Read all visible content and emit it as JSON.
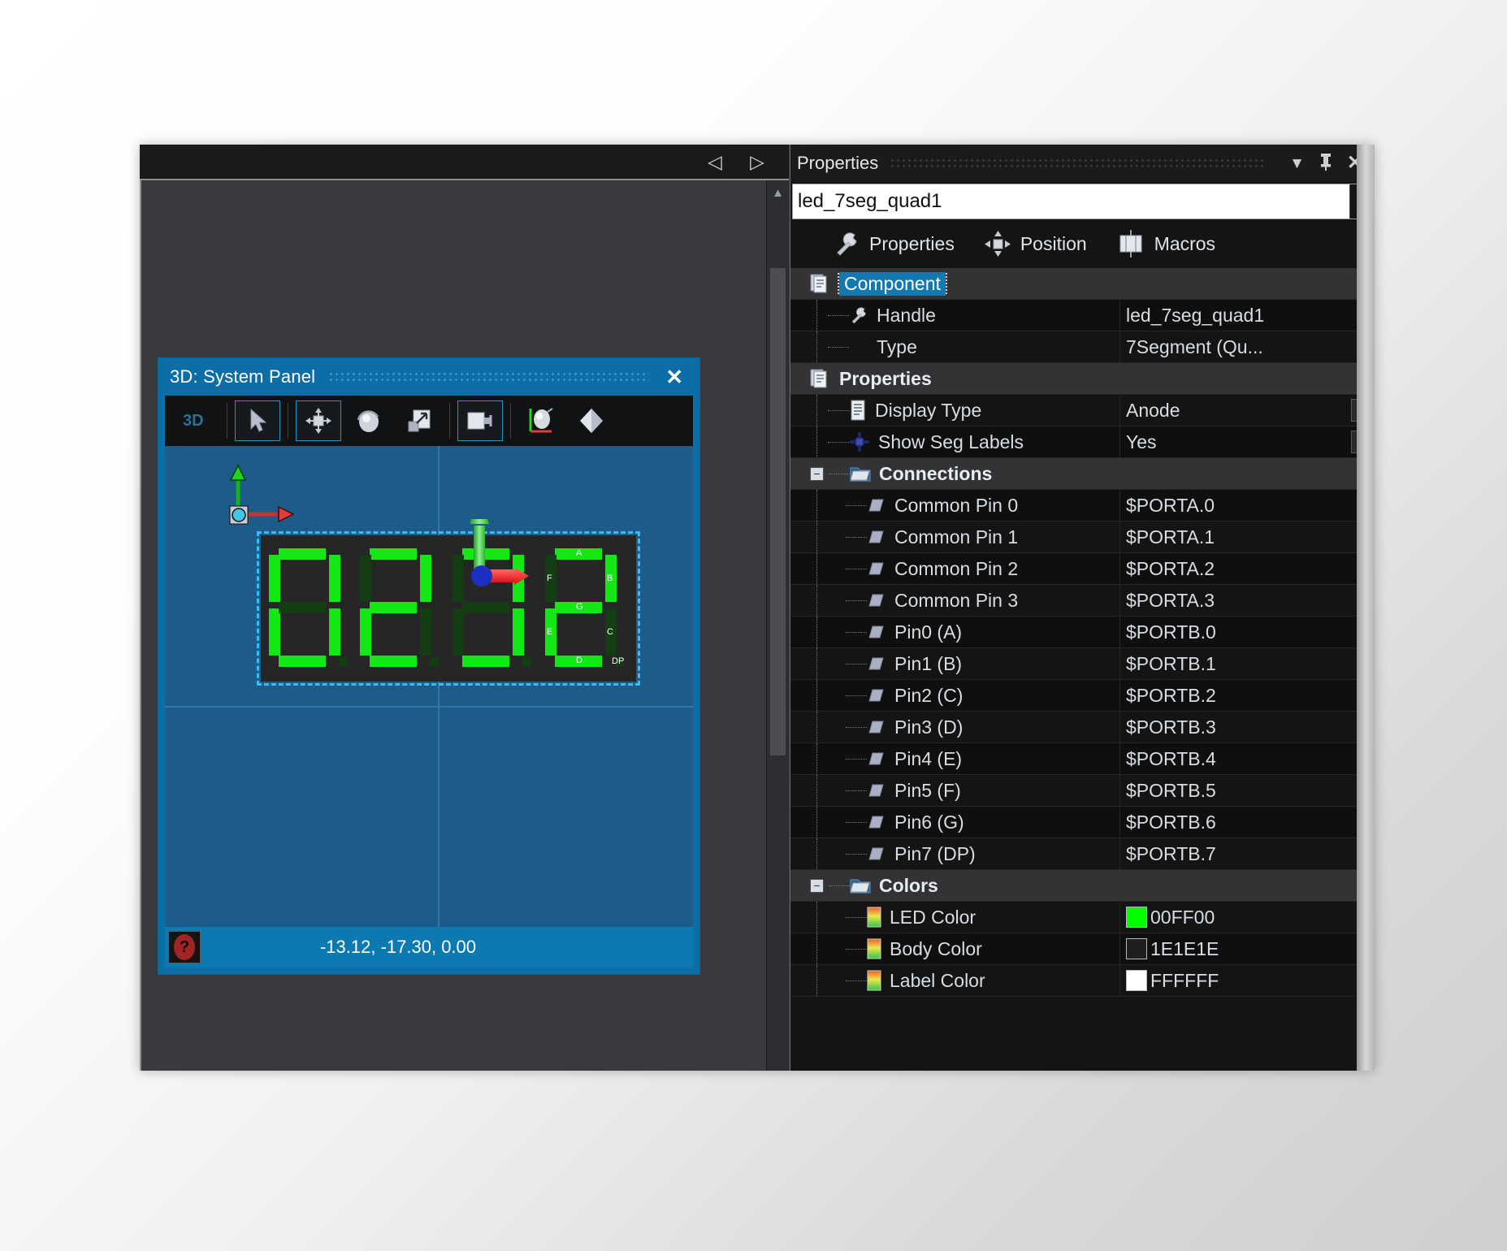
{
  "editor": {
    "nav_prev": "◁",
    "nav_next": "▷"
  },
  "panel3d": {
    "title": "3D: System Panel",
    "close_label": "✕",
    "toolbar": {
      "mode_label": "3D",
      "buttons": [
        {
          "name": "select-tool",
          "icon": "cursor-arrow-icon",
          "active": true
        },
        {
          "name": "move-tool",
          "icon": "move-arrows-icon",
          "active": true
        },
        {
          "name": "rotate-tool",
          "icon": "rotate-sphere-icon",
          "active": false
        },
        {
          "name": "scale-tool",
          "icon": "scale-arrow-icon",
          "active": false
        },
        {
          "name": "camera-tool",
          "icon": "camera-icon",
          "active": true
        },
        {
          "name": "lighting-tool",
          "icon": "light-sphere-axes-icon",
          "active": false
        },
        {
          "name": "render-tool",
          "icon": "cube-icon",
          "active": false
        }
      ]
    },
    "status": {
      "help_glyph": "?",
      "coordinates": "-13.12, -17.30, 0.00"
    },
    "component": {
      "digits": [
        {
          "value": "0",
          "segments": {
            "A": true,
            "B": true,
            "C": true,
            "D": true,
            "E": true,
            "F": true,
            "G": false,
            "DP": false
          }
        },
        {
          "value": "2",
          "segments": {
            "A": true,
            "B": true,
            "C": false,
            "D": true,
            "E": true,
            "F": false,
            "G": true,
            "DP": false
          }
        },
        {
          "value": "7",
          "segments": {
            "A": true,
            "B": true,
            "C": true,
            "D": true,
            "E": false,
            "F": false,
            "G": false,
            "DP": false
          }
        },
        {
          "value": "2",
          "segments": {
            "A": true,
            "B": true,
            "C": false,
            "D": true,
            "E": true,
            "F": false,
            "G": true,
            "DP": false
          }
        }
      ],
      "segment_labels": {
        "A": "A",
        "B": "B",
        "C": "C",
        "D": "D",
        "E": "E",
        "F": "F",
        "G": "G",
        "DP": "DP"
      },
      "led_on_color": "#14e814",
      "led_off_color": "#133d13",
      "body_color": "#262626"
    }
  },
  "properties_panel": {
    "title": "Properties",
    "header_icons": {
      "dropdown": "▼",
      "pin": "pin-icon",
      "close": "✕"
    },
    "combo_value": "led_7seg_quad1",
    "combo_caret": "▾",
    "tabs": [
      {
        "label": "Properties",
        "icon": "wrench-icon",
        "active": true
      },
      {
        "label": "Position",
        "icon": "move-arrows-icon",
        "active": false
      },
      {
        "label": "Macros",
        "icon": "macro-block-icon",
        "active": false
      }
    ],
    "rows": [
      {
        "kind": "group",
        "name": "Component",
        "selected": true,
        "icon": "documents-icon",
        "value": "",
        "expander": ""
      },
      {
        "kind": "item",
        "name": "Handle",
        "icon": "wrench-icon",
        "value": "led_7seg_quad1",
        "indent": 1
      },
      {
        "kind": "item",
        "name": "Type",
        "icon": "none-icon",
        "value": "7Segment (Qu...",
        "indent": 1
      },
      {
        "kind": "group",
        "name": "Properties",
        "icon": "documents-icon",
        "value": "",
        "expander": ""
      },
      {
        "kind": "item",
        "name": "Display Type",
        "icon": "list-icon",
        "value": "Anode",
        "indent": 1,
        "dropdown": true
      },
      {
        "kind": "item",
        "name": "Show Seg Labels",
        "icon": "plus-circle-icon",
        "value": "Yes",
        "indent": 1,
        "dropdown": true
      },
      {
        "kind": "group",
        "name": "Connections",
        "icon": "folder-icon",
        "value": "",
        "expander": "−"
      },
      {
        "kind": "item",
        "name": "Common Pin 0",
        "icon": "pin-slab-icon",
        "value": "$PORTA.0",
        "indent": 2
      },
      {
        "kind": "item",
        "name": "Common Pin 1",
        "icon": "pin-slab-icon",
        "value": "$PORTA.1",
        "indent": 2
      },
      {
        "kind": "item",
        "name": "Common Pin 2",
        "icon": "pin-slab-icon",
        "value": "$PORTA.2",
        "indent": 2
      },
      {
        "kind": "item",
        "name": "Common Pin 3",
        "icon": "pin-slab-icon",
        "value": "$PORTA.3",
        "indent": 2
      },
      {
        "kind": "item",
        "name": "Pin0 (A)",
        "icon": "pin-slab-icon",
        "value": "$PORTB.0",
        "indent": 2
      },
      {
        "kind": "item",
        "name": "Pin1 (B)",
        "icon": "pin-slab-icon",
        "value": "$PORTB.1",
        "indent": 2
      },
      {
        "kind": "item",
        "name": "Pin2 (C)",
        "icon": "pin-slab-icon",
        "value": "$PORTB.2",
        "indent": 2
      },
      {
        "kind": "item",
        "name": "Pin3 (D)",
        "icon": "pin-slab-icon",
        "value": "$PORTB.3",
        "indent": 2
      },
      {
        "kind": "item",
        "name": "Pin4 (E)",
        "icon": "pin-slab-icon",
        "value": "$PORTB.4",
        "indent": 2
      },
      {
        "kind": "item",
        "name": "Pin5 (F)",
        "icon": "pin-slab-icon",
        "value": "$PORTB.5",
        "indent": 2
      },
      {
        "kind": "item",
        "name": "Pin6 (G)",
        "icon": "pin-slab-icon",
        "value": "$PORTB.6",
        "indent": 2
      },
      {
        "kind": "item",
        "name": "Pin7 (DP)",
        "icon": "pin-slab-icon",
        "value": "$PORTB.7",
        "indent": 2
      },
      {
        "kind": "group",
        "name": "Colors",
        "icon": "folder-icon",
        "value": "",
        "expander": "−"
      },
      {
        "kind": "item",
        "name": "LED Color",
        "icon": "gradient-icon",
        "value": "00FF00",
        "indent": 2,
        "swatch": "#00ff00"
      },
      {
        "kind": "item",
        "name": "Body Color",
        "icon": "gradient-icon",
        "value": "1E1E1E",
        "indent": 2,
        "swatch": "#1e1e1e"
      },
      {
        "kind": "item",
        "name": "Label Color",
        "icon": "gradient-icon",
        "value": "FFFFFF",
        "indent": 2,
        "swatch": "#ffffff"
      }
    ]
  }
}
